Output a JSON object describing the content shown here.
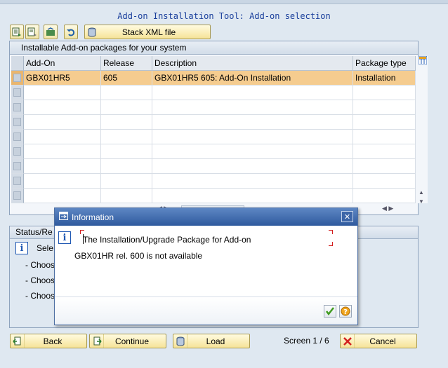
{
  "title": "Add-on Installation Tool: Add-on selection",
  "toolbar": {
    "stack_xml_label": "Stack XML file"
  },
  "table": {
    "caption": "Installable Add-on packages for your system",
    "columns": [
      "Add-On",
      "Release",
      "Description",
      "Package type"
    ],
    "rows": [
      [
        "GBX01HR5",
        "605",
        "GBX01HR5 605: Add-On Installation",
        "Installation"
      ]
    ],
    "empty_rows": 8
  },
  "status": {
    "header": "Status/Re",
    "lines": [
      "Sele",
      "- Choos",
      "- Choos",
      "- Choos"
    ]
  },
  "dialog": {
    "title": "Information",
    "message_line1": "The Installation/Upgrade Package for Add-on",
    "message_line2": "GBX01HR rel. 600 is not available"
  },
  "footer": {
    "back_label": "Back",
    "continue_label": "Continue",
    "load_label": "Load",
    "screen_label": "Screen 1 / 6",
    "cancel_label": "Cancel"
  },
  "colors": {
    "accent": "#1a3f9c",
    "selected_row": "#f5cc8f",
    "dialog_title": "#2f5a9e"
  }
}
